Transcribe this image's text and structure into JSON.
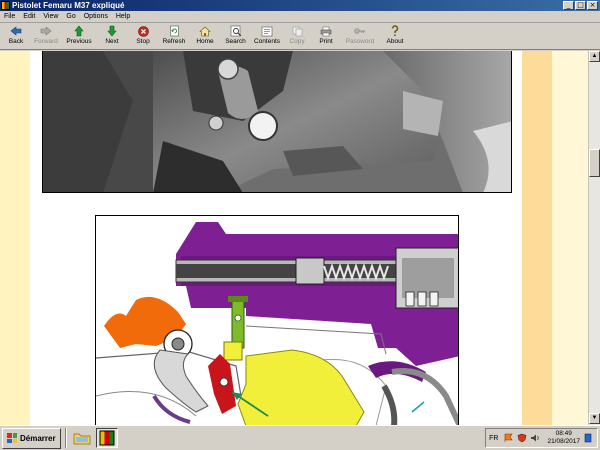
{
  "window": {
    "title": "Pistolet Femaru M37 expliqué",
    "min_label": "_",
    "max_label": "□",
    "close_label": "×"
  },
  "menu": [
    "File",
    "Edit",
    "View",
    "Go",
    "Options",
    "Help"
  ],
  "toolbar": {
    "back": "Back",
    "forward": "Forward",
    "previous": "Previous",
    "next": "Next",
    "stop": "Stop",
    "refresh": "Refresh",
    "home": "Home",
    "search": "Search",
    "contents": "Contents",
    "copy": "Copy",
    "print": "Print",
    "password": "Password",
    "about": "About"
  },
  "scrollbar": {
    "up": "▲",
    "down": "▼"
  },
  "taskbar": {
    "start_label": "Démarrer",
    "lang": "FR",
    "time": "08:49",
    "date": "21/08/2017"
  },
  "colors": {
    "accent_title": "#0a246a",
    "page_margin": "#fddc9a",
    "slide_purple": "#7e2094",
    "hammer_orange": "#f26b0a",
    "trigger_yellow": "#f2ef3a",
    "sear_red": "#c8151b"
  }
}
